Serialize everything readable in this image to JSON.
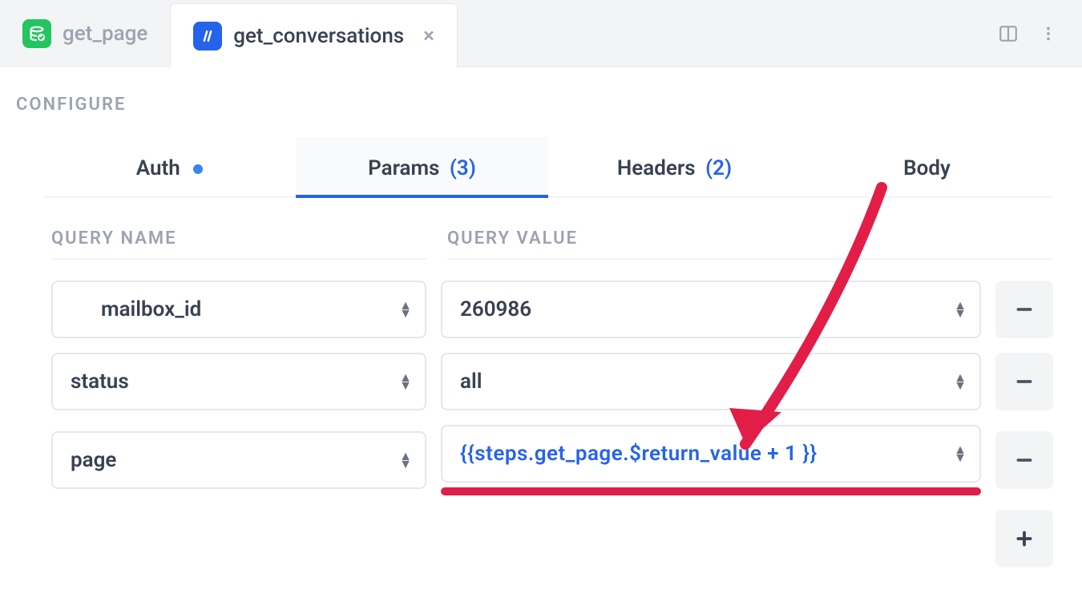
{
  "tabs": [
    {
      "label": "get_page",
      "icon": "db-check",
      "active": false
    },
    {
      "label": "get_conversations",
      "icon": "blue-slash",
      "active": true
    }
  ],
  "section_label": "CONFIGURE",
  "subtabs": {
    "auth": {
      "label": "Auth",
      "indicator": "dot"
    },
    "params": {
      "label": "Params",
      "count": "(3)",
      "active": true
    },
    "headers": {
      "label": "Headers",
      "count": "(2)"
    },
    "body": {
      "label": "Body"
    }
  },
  "table": {
    "head_name": "QUERY NAME",
    "head_value": "QUERY VALUE",
    "rows": [
      {
        "name": "mailbox_id",
        "value": "260986",
        "expr": false
      },
      {
        "name": "status",
        "value": "all",
        "expr": false
      },
      {
        "name": "page",
        "value": "{{steps.get_page.$return_value + 1 }}",
        "expr": true,
        "highlight": true
      }
    ]
  },
  "icons": {
    "remove": "—",
    "add": "+",
    "close": "×"
  }
}
